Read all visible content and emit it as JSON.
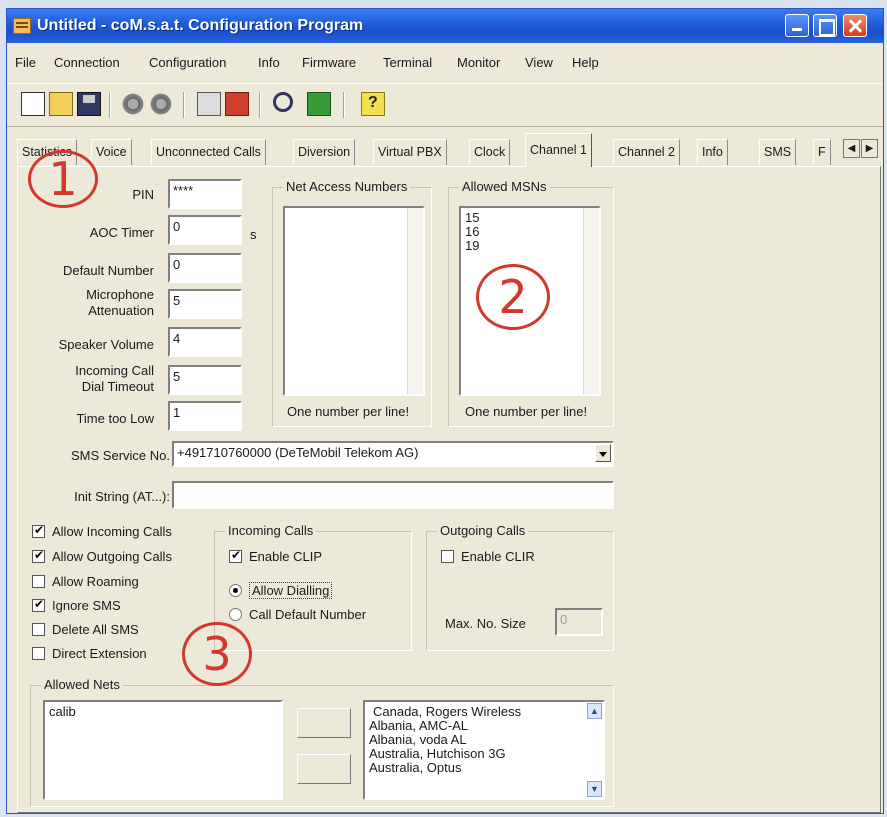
{
  "window": {
    "title": "Untitled - coM.s.a.t. Configuration Program"
  },
  "menu": [
    "File",
    "Connection",
    "Configuration",
    "Info",
    "Firmware",
    "Terminal",
    "Monitor",
    "View",
    "Help"
  ],
  "tabs": [
    "Statistics",
    "Voice",
    "Unconnected Calls",
    "Diversion",
    "Virtual PBX",
    "Clock",
    "Channel 1",
    "Channel 2",
    "Info",
    "SMS",
    "F"
  ],
  "active_tab": "Channel 1",
  "fields": {
    "pin": {
      "label": "PIN",
      "value": "****"
    },
    "aoc_timer": {
      "label": "AOC Timer",
      "value": "0",
      "unit": "s"
    },
    "default_number": {
      "label": "Default Number",
      "value": "0"
    },
    "mic_attenuation": {
      "label": "Microphone Attenuation",
      "value": "5"
    },
    "speaker_volume": {
      "label": "Speaker Volume",
      "value": "4"
    },
    "incoming_dial_timeout": {
      "label": "Incoming Call Dial Timeout",
      "value": "5"
    },
    "time_too_low": {
      "label": "Time too Low",
      "value": "1"
    },
    "sms_service": {
      "label": "SMS Service No.",
      "value": "+491710760000 (DeTeMobil Telekom AG)"
    },
    "init_string": {
      "label": "Init String (AT...):",
      "value": ""
    }
  },
  "net_access": {
    "title": "Net Access Numbers",
    "items": [],
    "hint": "One number per line!"
  },
  "allowed_msns": {
    "title": "Allowed MSNs",
    "items": [
      "15",
      "16",
      "19"
    ],
    "hint": "One number per line!"
  },
  "options": [
    {
      "label": "Allow Incoming Calls",
      "checked": true
    },
    {
      "label": "Allow Outgoing Calls",
      "checked": true
    },
    {
      "label": "Allow Roaming",
      "checked": false
    },
    {
      "label": "Ignore SMS",
      "checked": true
    },
    {
      "label": "Delete All SMS",
      "checked": false
    },
    {
      "label": "Direct Extension",
      "checked": false
    }
  ],
  "incoming_calls": {
    "title": "Incoming Calls",
    "enable_clip": {
      "label": "Enable CLIP",
      "checked": true
    },
    "allow_dialling": {
      "label": "Allow Dialling",
      "selected": true
    },
    "call_default": {
      "label": "Call Default Number",
      "selected": false
    }
  },
  "outgoing_calls": {
    "title": "Outgoing Calls",
    "enable_clir": {
      "label": "Enable CLIR",
      "checked": false
    },
    "max_no_size": {
      "label": "Max. No. Size",
      "value": "0"
    }
  },
  "allowed_nets": {
    "title": "Allowed Nets",
    "selected": [
      "calib"
    ],
    "available": [
      "Canada, Rogers Wireless",
      "Albania, AMC-AL",
      "Albania, voda AL",
      "Australia, Hutchison 3G",
      "Australia, Optus"
    ]
  },
  "markers": [
    "1",
    "2",
    "3"
  ],
  "colors": {
    "title_bar": "#1e5cd8",
    "window_bg": "#ece9d8",
    "marker": "#d0392b"
  }
}
